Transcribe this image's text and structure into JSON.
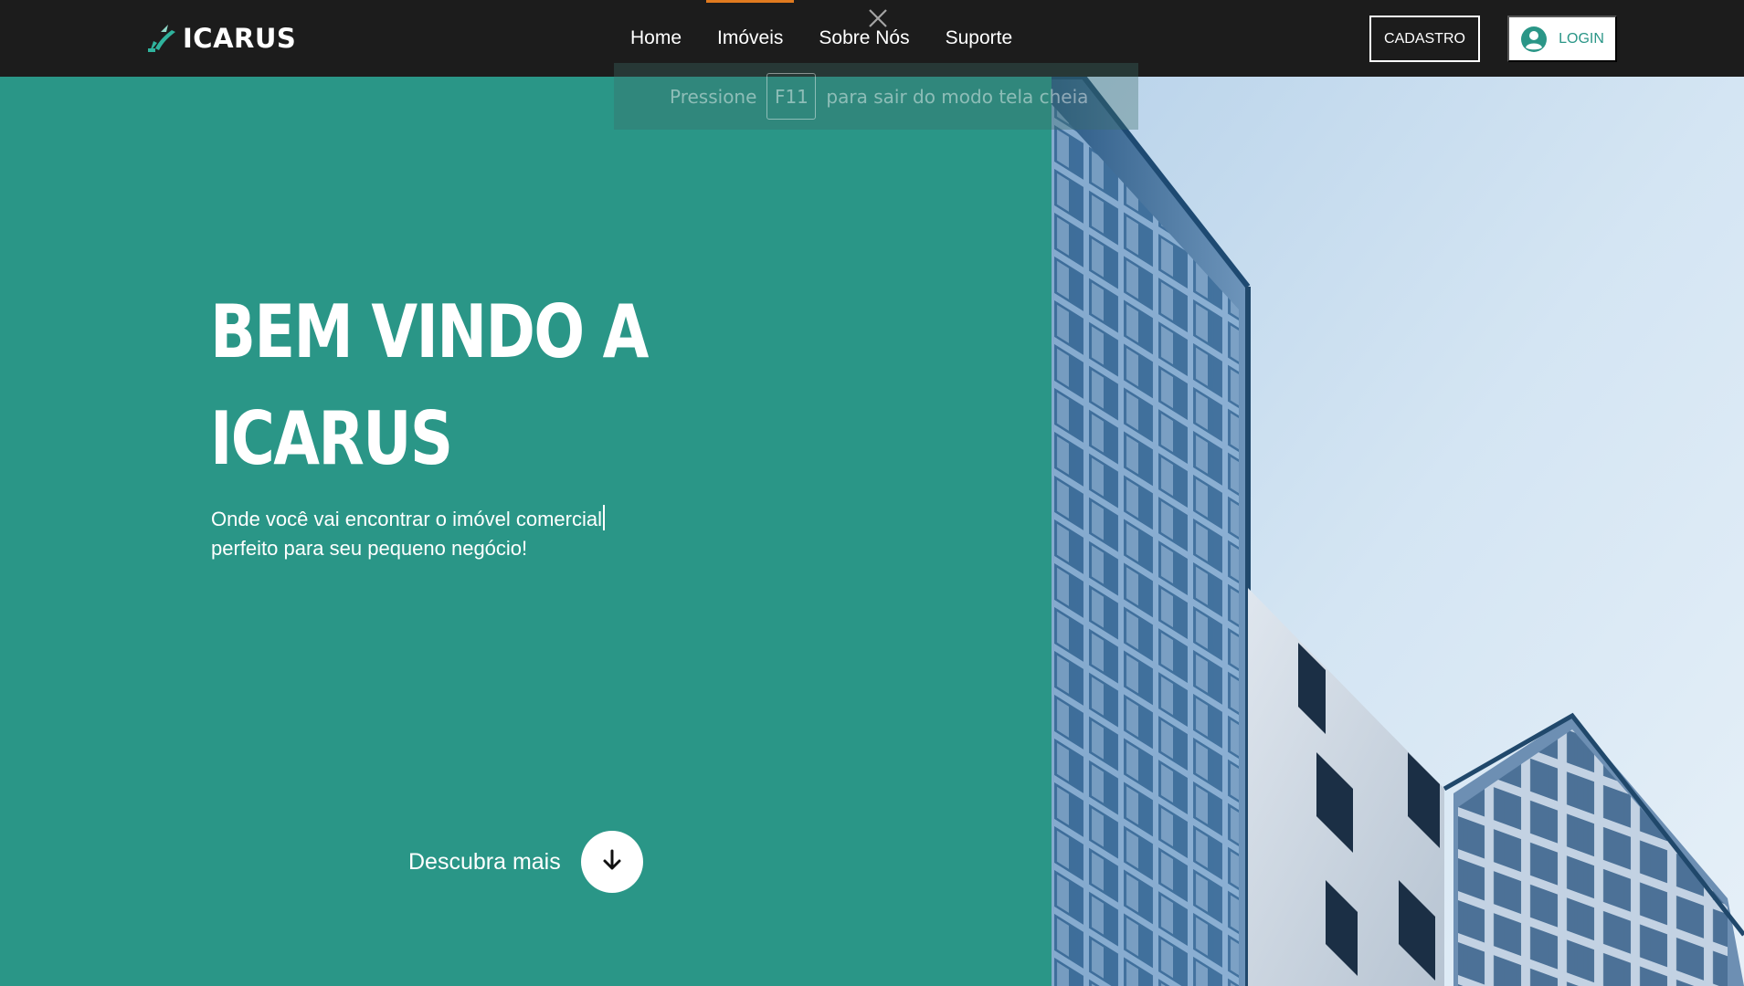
{
  "nav": {
    "brand": "ICARUS",
    "links": [
      {
        "label": "Home"
      },
      {
        "label": "Imóveis"
      },
      {
        "label": "Sobre Nós"
      },
      {
        "label": "Suporte"
      }
    ],
    "cadastro_label": "CADASTRO",
    "login_label": "LOGIN"
  },
  "fullscreen_notice": {
    "prefix": "Pressione",
    "key": "F11",
    "suffix": "para sair do modo tela cheia"
  },
  "hero": {
    "title_line1": "BEM VINDO A",
    "title_line2": "ICARUS",
    "subtitle_line1": "Onde você vai encontrar o imóvel comercial",
    "subtitle_line2": "perfeito para seu pequeno negócio!",
    "cta_label": "Descubra mais"
  },
  "colors": {
    "nav_bg": "#1c1c1c",
    "hero_bg": "#2a9687",
    "active_tab": "#e07a1f",
    "logo_accent": "#2fb39d"
  },
  "icons": {
    "logo": "icarus-logo-icon",
    "fullscreen_close": "close-icon",
    "login_user": "user-circle-icon",
    "cta": "arrow-down-icon"
  }
}
